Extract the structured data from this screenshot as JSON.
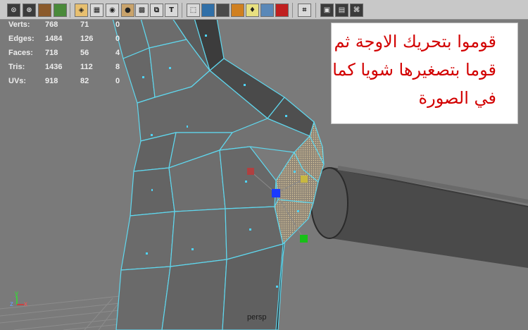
{
  "toolbar": {
    "icons": [
      "camera-icon",
      "camera-attribute-icon",
      "book-icon",
      "image-plane-icon",
      "select-camera-icon",
      "wireframe-icon",
      "smooth-shade-icon",
      "sphere-shade-icon",
      "grid-icon",
      "texture-icon",
      "text-icon",
      "wireframe-cube-icon",
      "shaded-cube-icon",
      "solid-cube-icon",
      "render-icon",
      "light-bulb-icon",
      "ambient-cube-icon",
      "red-cube-icon",
      "isolate-select-icon",
      "xray-cube-icon",
      "wireframe-on-shaded-icon",
      "camera-track-icon"
    ]
  },
  "hud": {
    "rows": [
      {
        "label": "Verts:",
        "v1": "768",
        "v2": "71",
        "v3": "0"
      },
      {
        "label": "Edges:",
        "v1": "1484",
        "v2": "126",
        "v3": "0"
      },
      {
        "label": "Faces:",
        "v1": "718",
        "v2": "56",
        "v3": "4"
      },
      {
        "label": "Tris:",
        "v1": "1436",
        "v2": "112",
        "v3": "8"
      },
      {
        "label": "UVs:",
        "v1": "918",
        "v2": "82",
        "v3": "0"
      }
    ]
  },
  "note": {
    "line1": "قوموا بتحريك الاوجة ثم",
    "line2": "قوما بتصغيرها شويا كما",
    "line3": "في الصورة"
  },
  "viewport": {
    "camera": "persp",
    "axis_y": "y",
    "axis_z": "z",
    "axis_x": "x"
  },
  "colors": {
    "wire": "#5fd8ef",
    "note_text": "#d20000"
  }
}
